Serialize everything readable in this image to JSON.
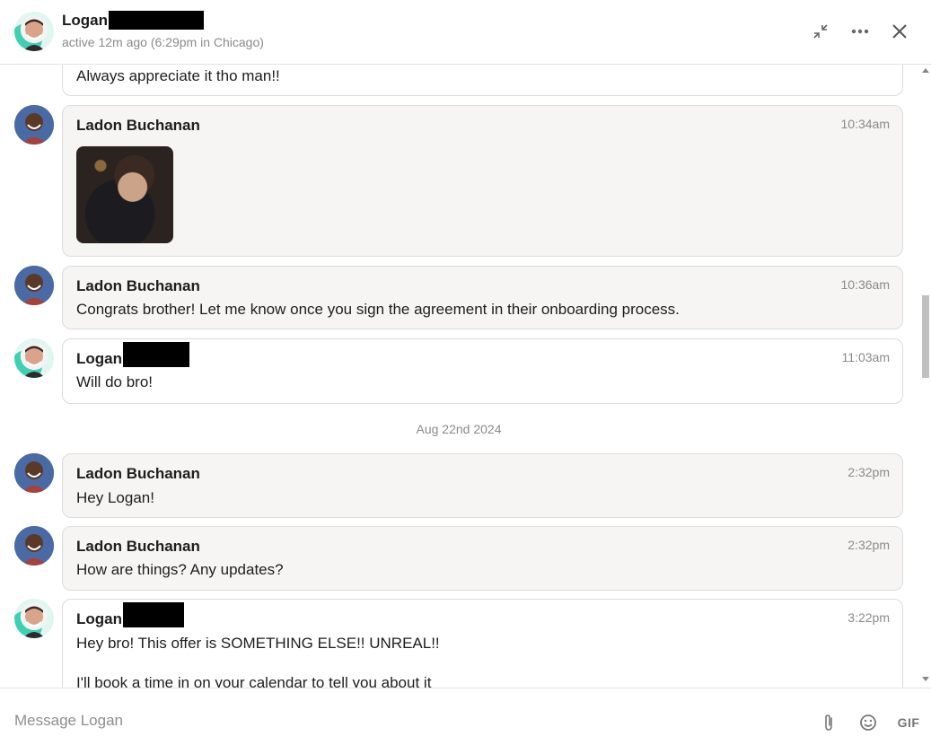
{
  "header": {
    "contact_name": "Logan",
    "status": "active 12m ago (6:29pm in Chicago)",
    "icons": [
      "minimize-icon",
      "more-icon",
      "close-icon"
    ]
  },
  "messages": [
    {
      "sender": "",
      "time": "",
      "text": "Always appreciate it tho man!!"
    },
    {
      "sender": "Ladon Buchanan",
      "time": "10:34am",
      "text": ""
    },
    {
      "sender": "Ladon Buchanan",
      "time": "10:36am",
      "text": "Congrats brother! Let me know once you sign the agreement in their onboarding process."
    },
    {
      "sender": "Logan",
      "time": "11:03am",
      "text": "Will do bro!"
    },
    {
      "sender": "Ladon Buchanan",
      "time": "2:32pm",
      "text": "Hey Logan!"
    },
    {
      "sender": "Ladon Buchanan",
      "time": "2:32pm",
      "text": "How are things? Any updates?"
    },
    {
      "sender": "Logan",
      "time": "3:22pm",
      "text": "Hey bro! This offer is SOMETHING ELSE!! UNREAL!!\n\nI'll book a time in on your calendar to tell you about it"
    }
  ],
  "date_separator": "Aug 22nd 2024",
  "composer": {
    "placeholder": "Message Logan",
    "gif_label": "GIF"
  },
  "colors": {
    "bubble_gray": "#f6f5f3",
    "border": "#dcdcdc",
    "muted_text": "#8a8a8a"
  }
}
